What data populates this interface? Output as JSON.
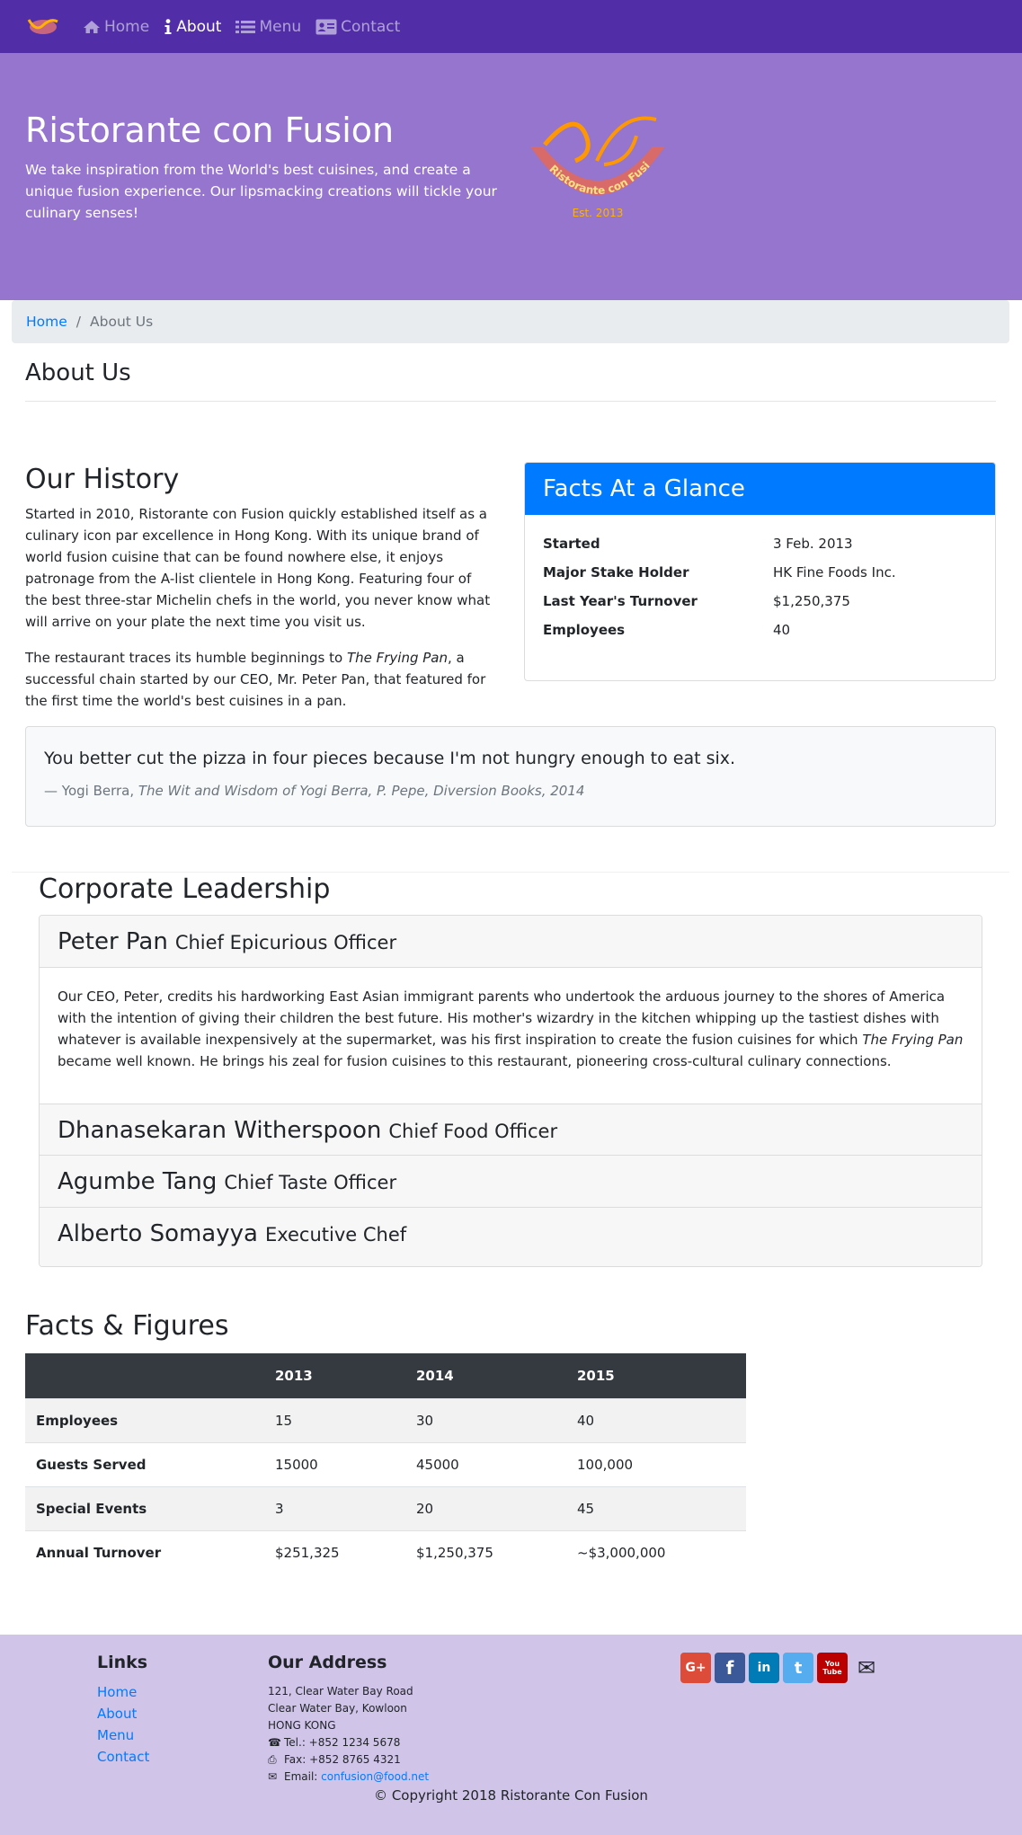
{
  "nav": {
    "items": [
      {
        "label": "Home",
        "icon": "home-icon"
      },
      {
        "label": "About",
        "icon": "info-icon",
        "active": true
      },
      {
        "label": "Menu",
        "icon": "list-icon"
      },
      {
        "label": "Contact",
        "icon": "address-card-icon"
      }
    ]
  },
  "jumbotron": {
    "title": "Ristorante con Fusion",
    "text": "We take inspiration from the World's best cuisines, and create a unique fusion experience. Our lipsmacking creations will tickle your culinary senses!",
    "logo_text": "Ristorante con Fusion",
    "logo_est": "Est. 2013"
  },
  "breadcrumb": {
    "home": "Home",
    "current": "About Us"
  },
  "page_title": "About Us",
  "history": {
    "title": "Our History",
    "p1": "Started in 2010, Ristorante con Fusion quickly established itself as a culinary icon par excellence in Hong Kong. With its unique brand of world fusion cuisine that can be found nowhere else, it enjoys patronage from the A-list clientele in Hong Kong. Featuring four of the best three-star Michelin chefs in the world, you never know what will arrive on your plate the next time you visit us.",
    "p2_a": "The restaurant traces its humble beginnings to ",
    "p2_em": "The Frying Pan",
    "p2_b": ", a successful chain started by our CEO, Mr. Peter Pan, that featured for the first time the world's best cuisines in a pan."
  },
  "facts": {
    "title": "Facts At a Glance",
    "rows": [
      {
        "k": "Started",
        "v": "3 Feb. 2013"
      },
      {
        "k": "Major Stake Holder",
        "v": "HK Fine Foods Inc."
      },
      {
        "k": "Last Year's Turnover",
        "v": "$1,250,375"
      },
      {
        "k": "Employees",
        "v": "40"
      }
    ]
  },
  "quote": {
    "text": "You better cut the pizza in four pieces because I'm not hungry enough to eat six.",
    "cite_prefix": "— Yogi Berra, ",
    "cite_em": "The Wit and Wisdom of Yogi Berra, P. Pepe, Diversion Books, 2014"
  },
  "leadership": {
    "title": "Corporate Leadership",
    "leaders": [
      {
        "name": "Peter Pan",
        "role": "Chief Epicurious Officer"
      },
      {
        "name": "Dhanasekaran Witherspoon",
        "role": "Chief Food Officer"
      },
      {
        "name": "Agumbe Tang",
        "role": "Chief Taste Officer"
      },
      {
        "name": "Alberto Somayya",
        "role": "Executive Chef"
      }
    ],
    "bio_a": "Our CEO, Peter, credits his hardworking East Asian immigrant parents who undertook the arduous journey to the shores of America with the intention of giving their children the best future. His mother's wizardry in the kitchen whipping up the tastiest dishes with whatever is available inexpensively at the supermarket, was his first inspiration to create the fusion cuisines for which ",
    "bio_em": "The Frying Pan",
    "bio_b": " became well known. He brings his zeal for fusion cuisines to this restaurant, pioneering cross-cultural culinary connections."
  },
  "figures": {
    "title": "Facts & Figures",
    "headers": [
      "",
      "2013",
      "2014",
      "2015"
    ],
    "rows": [
      [
        "Employees",
        "15",
        "30",
        "40"
      ],
      [
        "Guests Served",
        "15000",
        "45000",
        "100,000"
      ],
      [
        "Special Events",
        "3",
        "20",
        "45"
      ],
      [
        "Annual Turnover",
        "$251,325",
        "$1,250,375",
        "~$3,000,000"
      ]
    ]
  },
  "footer": {
    "links_title": "Links",
    "links": [
      "Home",
      "About",
      "Menu",
      "Contact"
    ],
    "address_title": "Our Address",
    "address_lines": [
      "121, Clear Water Bay Road",
      "Clear Water Bay, Kowloon",
      "HONG KONG"
    ],
    "tel": "Tel.: +852 1234 5678",
    "fax": "Fax: +852 8765 4321",
    "email_label": "Email: ",
    "email": "confusion@food.net",
    "social": [
      {
        "icon": "google-plus-icon",
        "glyph": "G+",
        "color": "#dd4b39"
      },
      {
        "icon": "facebook-icon",
        "glyph": "f",
        "color": "#3b5998"
      },
      {
        "icon": "linkedin-icon",
        "glyph": "in",
        "color": "#007bb6"
      },
      {
        "icon": "twitter-icon",
        "glyph": "t",
        "color": "#55acee"
      },
      {
        "icon": "youtube-icon",
        "glyph": "You Tube",
        "color": "#bb0000"
      },
      {
        "icon": "mail-icon",
        "glyph": "✉",
        "color": ""
      }
    ],
    "copyright": "© Copyright 2018 Ristorante Con Fusion"
  },
  "colors": {
    "navbar": "#512da8",
    "jumbotron": "#9575cd",
    "footer": "#d1c4e9",
    "card_header": "#007bff"
  }
}
